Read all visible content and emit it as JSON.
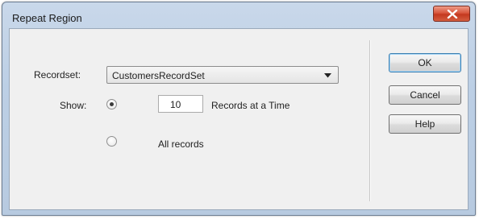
{
  "window": {
    "title": "Repeat Region"
  },
  "form": {
    "recordset_label": "Recordset:",
    "recordset_value": "CustomersRecordSet",
    "show_label": "Show:",
    "records_count": "10",
    "records_at_a_time_label": "Records at a Time",
    "all_records_label": "All records",
    "selected_option": "records_at_a_time"
  },
  "buttons": {
    "ok": "OK",
    "cancel": "Cancel",
    "help": "Help"
  },
  "icons": {
    "close": "close-icon",
    "dropdown": "dropdown-arrow-icon"
  },
  "colors": {
    "titlebar": "#bccfe5",
    "close_button": "#d8573e",
    "dialog_body": "#f0f0f0"
  }
}
